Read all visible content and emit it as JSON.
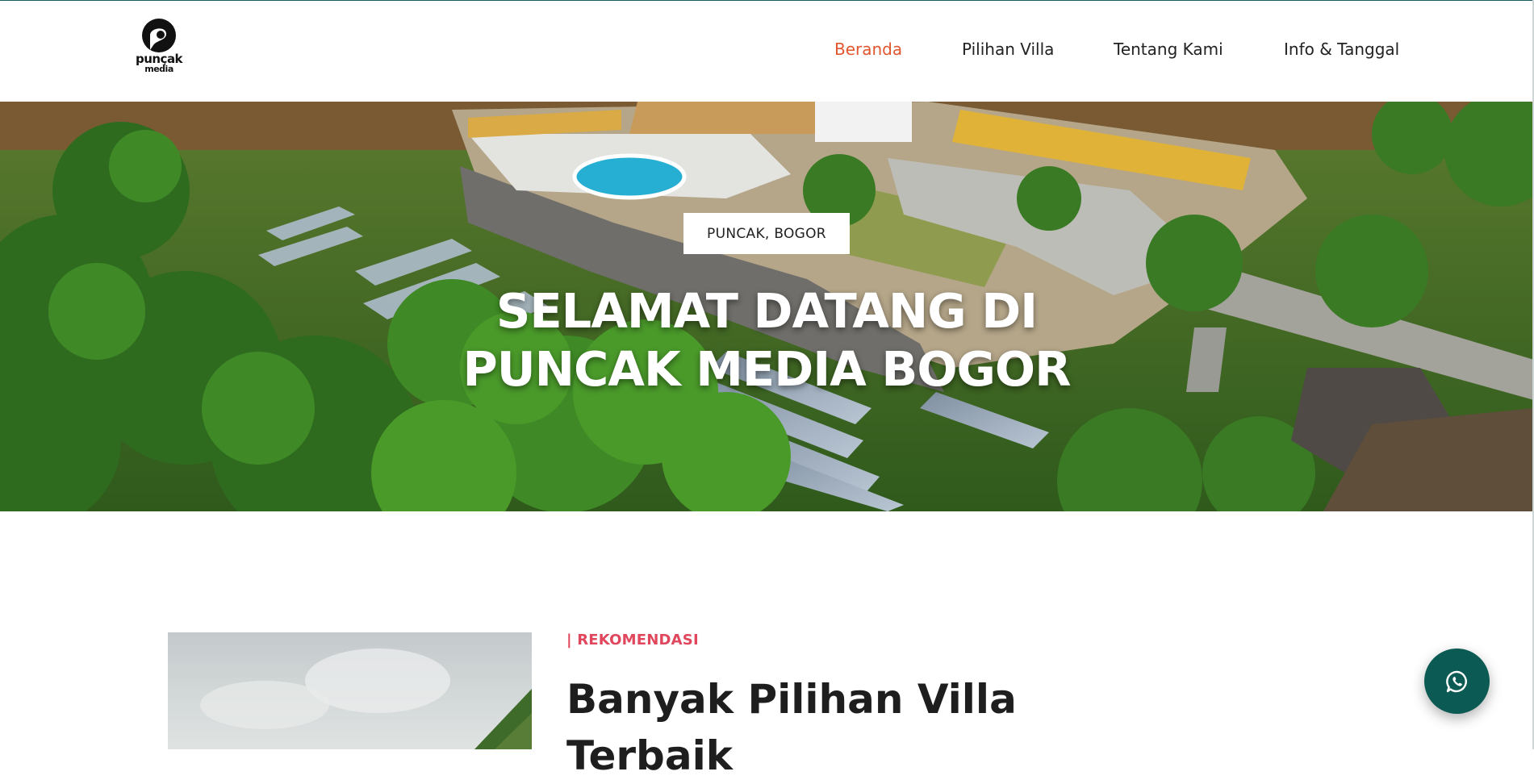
{
  "brand": {
    "logo_line1": "punçak",
    "logo_line2": "media",
    "icon": "puncak-media-logo"
  },
  "nav": {
    "items": [
      {
        "label": "Beranda",
        "active": true
      },
      {
        "label": "Pilihan Villa",
        "active": false
      },
      {
        "label": "Tentang Kami",
        "active": false
      },
      {
        "label": "Info & Tanggal",
        "active": false
      }
    ]
  },
  "hero": {
    "badge": "PUNCAK, BOGOR",
    "title_line1": "SELAMAT DATANG DI",
    "title_line2": "PUNCAK MEDIA BOGOR"
  },
  "recommendation": {
    "label": "| REKOMENDASI",
    "heading": "Banyak Pilihan Villa Terbaik"
  },
  "floating": {
    "icon": "whatsapp-icon"
  },
  "colors": {
    "accent_nav": "#e0562f",
    "accent_label": "#e0465c",
    "whatsapp_bg": "#0b5a53"
  }
}
